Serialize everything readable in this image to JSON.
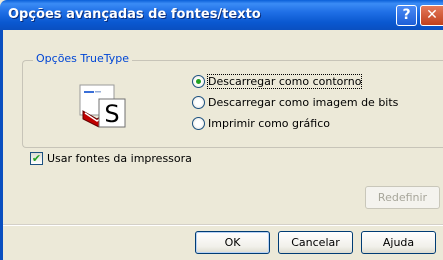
{
  "window": {
    "title": "Opções avançadas de fontes/texto",
    "help_glyph": "?",
    "close_glyph": "✕"
  },
  "truetype_group": {
    "label": "Opções TrueType",
    "icon": "truetype-font-icon",
    "options": [
      {
        "label": "Descarregar como contorno",
        "selected": true
      },
      {
        "label": "Descarregar como imagem de bits",
        "selected": false
      },
      {
        "label": "Imprimir como gráfico",
        "selected": false
      }
    ]
  },
  "printer_fonts": {
    "label": "Usar fontes da impressora",
    "checked": true
  },
  "buttons": {
    "reset": "Redefinir",
    "ok": "OK",
    "cancel": "Cancelar",
    "help": "Ajuda"
  },
  "colors": {
    "titlebar": "#0a58d0",
    "group_label": "#0046d5",
    "dialog_bg": "#ece9d8"
  }
}
